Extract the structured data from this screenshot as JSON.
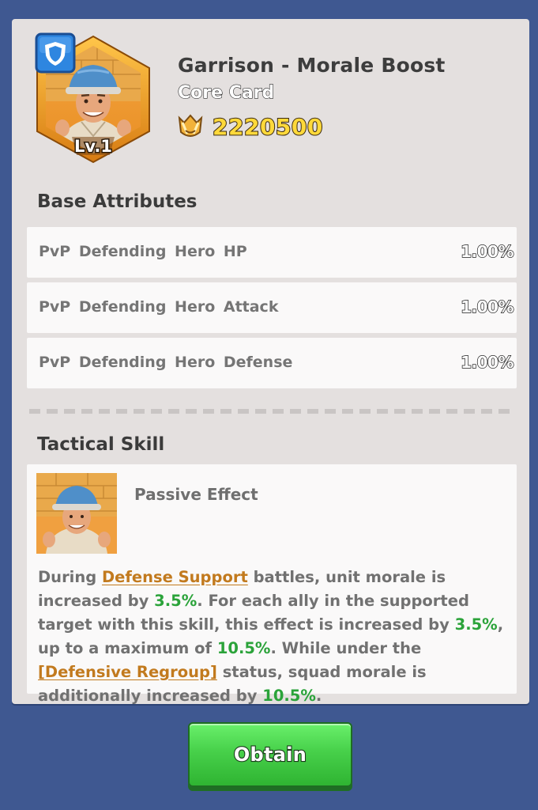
{
  "card": {
    "title": "Garrison - Morale Boost",
    "subtitle": "Core Card",
    "level": "Lv.1",
    "power": "2220500"
  },
  "base_attributes": {
    "heading": "Base Attributes",
    "items": [
      {
        "label": "PvP  Defending Hero HP",
        "value": "1.00%"
      },
      {
        "label": "PvP  Defending Hero Attack",
        "value": "1.00%"
      },
      {
        "label": "PvP  Defending Hero Defense",
        "value": "1.00%"
      }
    ]
  },
  "tactical_skill": {
    "heading": "Tactical Skill",
    "type": "Passive Effect",
    "description": {
      "t1": "During ",
      "link1": "Defense Support",
      "t2": " battles, unit morale is increased by ",
      "v1": "3.5%",
      "t3": ". For each ally in the supported target with this skill, this effect is increased by ",
      "v2": "3.5%",
      "t4": ", up to a maximum of ",
      "v3": "10.5%",
      "t5": ". While under the ",
      "link2": "[Defensive Regroup]",
      "t6": " status, squad morale is additionally increased by ",
      "v4": "10.5%",
      "t7": "."
    }
  },
  "actions": {
    "obtain_label": "Obtain"
  },
  "colors": {
    "background": "#3f5891",
    "panel": "#e4e0df",
    "power_text": "#ffd93a",
    "link": "#c27a1e",
    "value_green": "#2ba33a",
    "button_green": "#47d04a"
  },
  "icons": [
    "shield-icon",
    "power-crest-icon",
    "hero-portrait",
    "skill-portrait"
  ]
}
